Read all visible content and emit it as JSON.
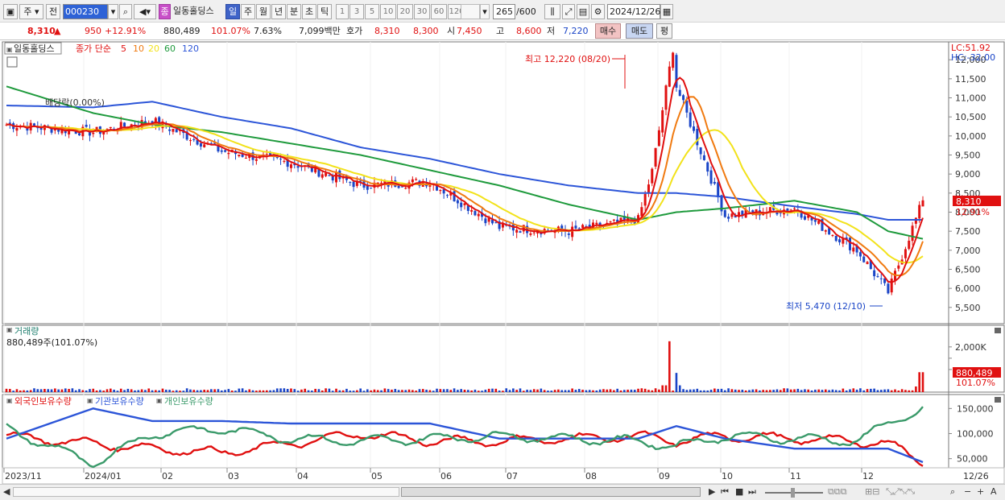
{
  "toolbar": {
    "period_dropdown": "주",
    "prev_label": "전",
    "stock_code": "000230",
    "stock_name": "일동홀딩스",
    "stock_badge": "종",
    "period_tabs": [
      "일",
      "주",
      "월",
      "년",
      "분",
      "초",
      "틱"
    ],
    "active_period": "일",
    "tick_buttons": [
      "1",
      "3",
      "5",
      "10",
      "20",
      "30",
      "60",
      "120"
    ],
    "count_display": "265",
    "count_total": "/600",
    "date": "2024/12/26"
  },
  "quote": {
    "price": "8,310",
    "change": "950",
    "change_pct": "+12.91%",
    "volume": "880,489",
    "volume_ratio": "101.07%",
    "turnover": "7.63%",
    "amount": "7,099백만",
    "ask_label": "호가",
    "ask1": "8,310",
    "ask2": "8,300",
    "open_label": "시",
    "open": "7,450",
    "high_label": "고",
    "high": "8,600",
    "low_label": "저",
    "low": "7,220",
    "buy_label": "매수",
    "sell_label": "매도",
    "eval_label": "평"
  },
  "colors": {
    "up": "#e01010",
    "down": "#1a45c7",
    "ma5": "#e01010",
    "ma10": "#f07a10",
    "ma20": "#f2e21a",
    "ma60": "#1e9a3c",
    "ma120": "#2c55d8",
    "foreign": "#e01010",
    "inst": "#2c55d8",
    "retail": "#3a9a6a"
  },
  "price_panel": {
    "stock_label": "일동홀딩스",
    "ma_label": "종가 단순",
    "ma_periods": [
      "5",
      "10",
      "20",
      "60",
      "120"
    ],
    "lc": "LC:51.92",
    "hc": "HC:-32.00",
    "dividend_note": "배당락(0.00%)",
    "high_note": "최고 12,220 (08/20)",
    "low_note": "최저 5,470 (12/10)",
    "last_price_tag": "8,310",
    "last_pct_tag": "12.91%"
  },
  "volume_panel": {
    "title": "거래량",
    "value_line": "880,489주(101.07%)",
    "tag_value": "880,489",
    "tag_pct": "101.07%"
  },
  "holder_panel": {
    "series_labels": [
      "외국인보유수량",
      "기관보유수량",
      "개인보유수량"
    ]
  },
  "x_axis_labels": [
    "2023/11",
    "2024/01",
    "02",
    "03",
    "04",
    "05",
    "06",
    "07",
    "08",
    "09",
    "10",
    "11",
    "12",
    "12/26"
  ],
  "chart_data": [
    {
      "type": "candlestick",
      "title": "일동홀딩스 종가 단순 5 10 20 60 120",
      "y_ticks": [
        5500,
        6000,
        6500,
        7000,
        7500,
        8000,
        8500,
        9000,
        9500,
        10000,
        10500,
        11000,
        11500,
        12000
      ],
      "ylim": [
        5200,
        12300
      ],
      "series": [
        {
          "name": "close",
          "x": [
            "2023/11",
            "2023/12",
            "2024/01",
            "02",
            "03",
            "04",
            "05",
            "06",
            "07",
            "08",
            "08/20",
            "09",
            "10",
            "11",
            "12/10",
            "12/26"
          ],
          "values": [
            10300,
            10100,
            10400,
            9600,
            9300,
            8700,
            8800,
            7600,
            7500,
            7800,
            11300,
            7900,
            8100,
            7000,
            5900,
            8310
          ]
        },
        {
          "name": "120",
          "values": [
            10800,
            10750,
            10900,
            10500,
            10200,
            9700,
            9400,
            9000,
            8700,
            8500,
            8500,
            8400,
            8150,
            7950,
            7800,
            7800
          ]
        },
        {
          "name": "60",
          "values": [
            11300,
            10600,
            10300,
            10100,
            9800,
            9500,
            9100,
            8700,
            8200,
            7800,
            8000,
            8100,
            8300,
            8000,
            7500,
            7300
          ]
        }
      ],
      "high": {
        "value": 12220,
        "date": "08/20"
      },
      "low": {
        "value": 5470,
        "date": "12/10"
      }
    },
    {
      "type": "bar",
      "title": "거래량",
      "y_ticks": [
        1000000,
        1500000,
        2000000
      ],
      "y_tick_labels": [
        "2,000K"
      ],
      "last_value": 880489
    },
    {
      "type": "line",
      "y_ticks": [
        50000,
        100000,
        150000
      ],
      "series": [
        {
          "name": "외국인보유수량",
          "values": [
            95000,
            80000,
            70000,
            62000,
            80000,
            100000,
            85000,
            85000,
            90000,
            95000,
            85000,
            95000,
            90000,
            85000,
            80000,
            45000
          ]
        },
        {
          "name": "기관보유수량",
          "values": [
            90000,
            150000,
            125000,
            125000,
            120000,
            120000,
            120000,
            90000,
            90000,
            90000,
            115000,
            90000,
            70000,
            70000,
            70000,
            43000
          ]
        },
        {
          "name": "개인보유수량",
          "values": [
            110000,
            40000,
            100000,
            110000,
            90000,
            85000,
            90000,
            95000,
            90000,
            85000,
            75000,
            95000,
            90000,
            85000,
            120000,
            150000
          ]
        }
      ]
    }
  ]
}
